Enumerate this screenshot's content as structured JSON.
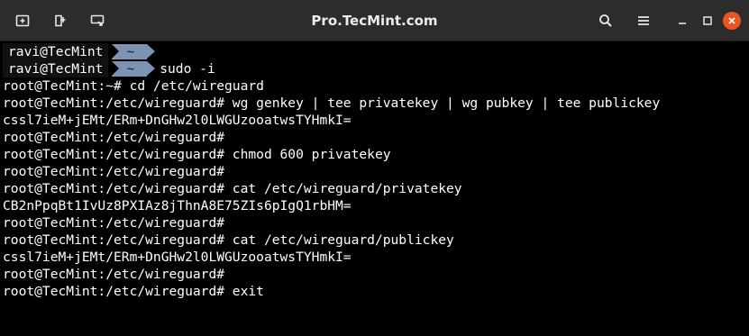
{
  "window": {
    "title": "Pro.TecMint.com",
    "accent_color": "#e95420",
    "titlebar_color": "#2c2c2c"
  },
  "toolbar": {
    "left_icons": [
      "new-tab-icon",
      "split-terminal-icon",
      "detach-icon"
    ],
    "right_icons": [
      "search-icon",
      "menu-icon",
      "minimize-icon",
      "maximize-icon",
      "close-icon"
    ]
  },
  "prompt": {
    "user": "ravi@TecMint",
    "dir": "~",
    "dir_color": "#7d93b4"
  },
  "terminal": {
    "powerline_cmd": "sudo -i",
    "lines": [
      "root@TecMint:~# cd /etc/wireguard",
      "root@TecMint:/etc/wireguard# wg genkey | tee privatekey | wg pubkey | tee publickey",
      "cssl7ieM+jEMt/ERm+DnGHw2l0LWGUzooatwsTYHmkI=",
      "root@TecMint:/etc/wireguard#",
      "root@TecMint:/etc/wireguard# chmod 600 privatekey",
      "root@TecMint:/etc/wireguard#",
      "root@TecMint:/etc/wireguard# cat /etc/wireguard/privatekey",
      "CB2nPpqBt1IvUz8PXIAz8jThnA8E75ZIs6pIgQ1rbHM=",
      "root@TecMint:/etc/wireguard#",
      "root@TecMint:/etc/wireguard# cat /etc/wireguard/publickey",
      "cssl7ieM+jEMt/ERm+DnGHw2l0LWGUzooatwsTYHmkI=",
      "root@TecMint:/etc/wireguard#",
      "root@TecMint:/etc/wireguard# exit"
    ]
  }
}
